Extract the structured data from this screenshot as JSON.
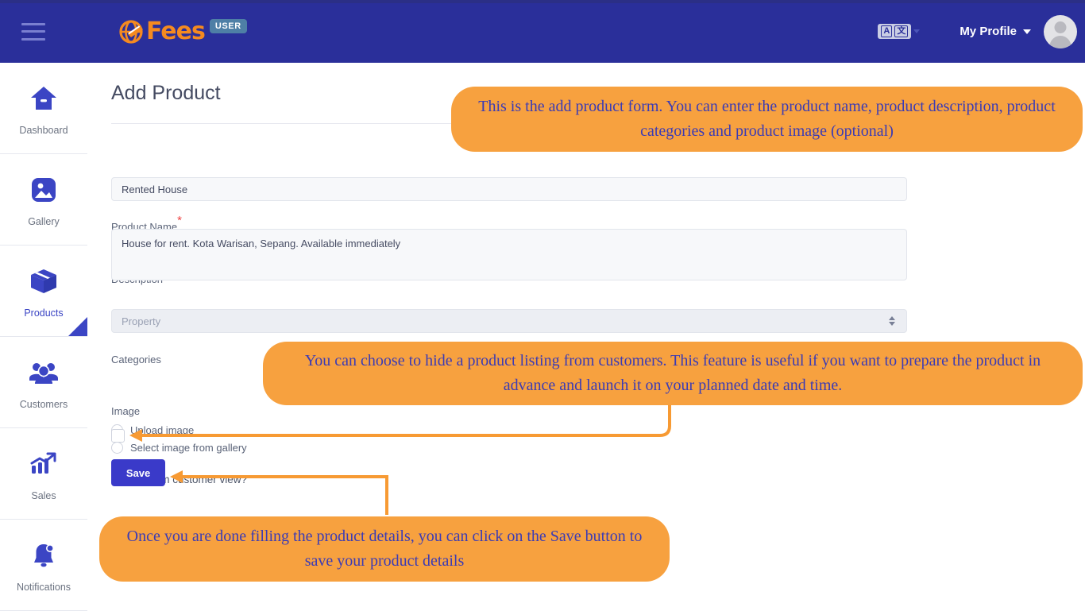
{
  "header": {
    "menu_icon": "hamburger-menu-icon",
    "logo_text": "Fees",
    "logo_icon": "efees-globe-logo",
    "user_badge": "USER",
    "language_icon": "language-translate-icon",
    "language_left": "A",
    "language_right": "文",
    "profile_label": "My Profile",
    "avatar_icon": "user-avatar-icon"
  },
  "sidebar": {
    "items": [
      {
        "label": "Dashboard",
        "icon": "home-icon",
        "active": false
      },
      {
        "label": "Gallery",
        "icon": "image-icon",
        "active": false
      },
      {
        "label": "Products",
        "icon": "box-package-icon",
        "active": true
      },
      {
        "label": "Customers",
        "icon": "users-group-icon",
        "active": false
      },
      {
        "label": "Sales",
        "icon": "chart-growth-icon",
        "active": false
      },
      {
        "label": "Notifications",
        "icon": "bell-icon",
        "active": false
      }
    ]
  },
  "main": {
    "page_title": "Add Product",
    "product_name": {
      "label": "Product Name",
      "required_marker": "*",
      "value": "Rented House",
      "placeholder": "Product Name"
    },
    "description": {
      "label": "Description",
      "value": "House for rent. Kota Warisan, Sepang. Available immediately",
      "placeholder": "Description"
    },
    "categories": {
      "label": "Categories",
      "selected": "Property",
      "options": [
        "Property"
      ]
    },
    "image": {
      "label": "Image",
      "options": [
        {
          "label": "Upload image",
          "selected": false
        },
        {
          "label": "Select image from gallery",
          "selected": false
        }
      ]
    },
    "hidden_toggle": {
      "label": "Hidden from customer view?",
      "checked": false
    },
    "save_label": "Save"
  },
  "callouts": [
    {
      "text": "This is the add product form. You can enter the product name, product description, product categories and product image (optional)"
    },
    {
      "text": "You can choose to hide a product listing from customers. This feature is useful if you want to prepare the product in advance and launch it on your planned date and time."
    },
    {
      "text": "Once you are done filling the product details, you can click on the Save button to save your product details"
    }
  ],
  "colors": {
    "header_blue": "#2a2f9a",
    "accent_blue": "#3b45c4",
    "logo_orange": "#f58a20",
    "callout_orange": "#f7a13f",
    "callout_text": "#3b3bb5",
    "required_red": "#ef4444",
    "badge_blue": "#4e7fa6"
  }
}
